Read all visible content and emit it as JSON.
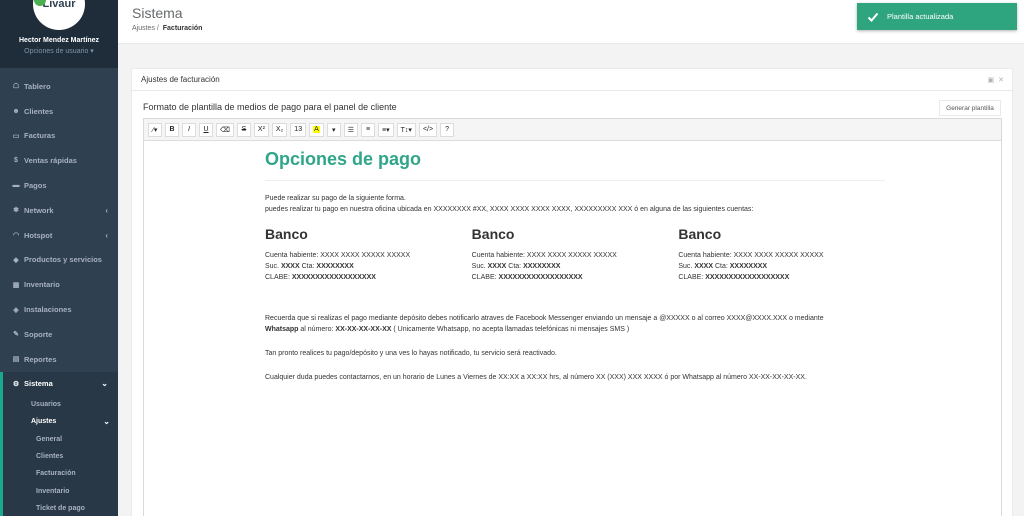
{
  "brand": {
    "logo_text": "Livaur"
  },
  "user": {
    "name": "Hector Mendez Martínez",
    "options": "Opciones de usuario ▾"
  },
  "nav": [
    {
      "icon": "dashboard-icon",
      "glyph": "☖",
      "label": "Tablero"
    },
    {
      "icon": "users-icon",
      "glyph": "☻",
      "label": "Clientes"
    },
    {
      "icon": "file-icon",
      "glyph": "▭",
      "label": "Facturas"
    },
    {
      "icon": "dollar-icon",
      "glyph": "$",
      "label": "Ventas rápidas"
    },
    {
      "icon": "money-icon",
      "glyph": "▬",
      "label": "Pagos"
    },
    {
      "icon": "network-icon",
      "glyph": "✱",
      "label": "Network",
      "chevron": "‹"
    },
    {
      "icon": "wifi-icon",
      "glyph": "◠",
      "label": "Hotspot",
      "chevron": "‹"
    },
    {
      "icon": "tags-icon",
      "glyph": "◆",
      "label": "Productos y servicios"
    },
    {
      "icon": "cubes-icon",
      "glyph": "▦",
      "label": "Inventario"
    },
    {
      "icon": "install-icon",
      "glyph": "◈",
      "label": "Instalaciones"
    },
    {
      "icon": "wrench-icon",
      "glyph": "✎",
      "label": "Soporte"
    },
    {
      "icon": "book-icon",
      "glyph": "▤",
      "label": "Reportes"
    },
    {
      "icon": "cogs-icon",
      "glyph": "⚙",
      "label": "Sistema",
      "chevron": "⌄"
    }
  ],
  "subnav": {
    "usuarios": "Usuarios",
    "ajustes": "Ajustes",
    "ajustes_chevron": "⌄",
    "ajustes_items": [
      "General",
      "Clientes",
      "Facturación",
      "Inventario",
      "Ticket de pago"
    ]
  },
  "header": {
    "title": "Sistema",
    "crumb_parent": "Ajustes",
    "crumb_sep": "/",
    "crumb_current": "Facturación"
  },
  "toast": {
    "text": "Plantilla actualizada"
  },
  "panel": {
    "title": "Ajustes de facturación",
    "tools": [
      "▣",
      "✕"
    ],
    "section_title": "Formato de plantilla de medios de pago para el panel de cliente",
    "generate_button": "Generar plantilla"
  },
  "toolbar": {
    "magic": "⁄▾",
    "bold": "B",
    "italic": "I",
    "underline": "U",
    "eraser": "⌫",
    "strike": "S",
    "sup": "X²",
    "sub": "X₂",
    "font_size": "13",
    "color": "A",
    "color_caret": "▾",
    "ul": "☰",
    "ol": "≡",
    "align": "≡▾",
    "height": "T↕▾",
    "code": "</>",
    "help": "?"
  },
  "template": {
    "title": "Opciones de pago",
    "intro_1": "Puede realizar su pago de la siguiente forma.",
    "intro_2": "puedes realizar tu pago en nuestra oficina ubicada en XXXXXXXX #XX, XXXX XXXX XXXX XXXX, XXXXXXXXX XXX ó en alguna de las siguientes cuentas:",
    "banks": [
      {
        "name": "Banco",
        "holder": "Cuenta habiente: XXXX XXXX XXXXX XXXXX",
        "suc_label": "Suc.",
        "suc": "XXXX",
        "cta_label": "Cta:",
        "cta": "XXXXXXXX",
        "clabe_label": "CLABE:",
        "clabe": "XXXXXXXXXXXXXXXXXX"
      },
      {
        "name": "Banco",
        "holder": "Cuenta habiente: XXXX XXXX XXXXX XXXXX",
        "suc_label": "Suc.",
        "suc": "XXXX",
        "cta_label": "Cta:",
        "cta": "XXXXXXXX",
        "clabe_label": "CLABE:",
        "clabe": "XXXXXXXXXXXXXXXXXX"
      },
      {
        "name": "Banco",
        "holder": "Cuenta habiente: XXXX XXXX XXXXX XXXXX",
        "suc_label": "Suc.",
        "suc": "XXXX",
        "cta_label": "Cta:",
        "cta": "XXXXXXXX",
        "clabe_label": "CLABE:",
        "clabe": "XXXXXXXXXXXXXXXXXX"
      }
    ],
    "note_1a": "Recuerda que si realizas el pago mediante depósito debes notificarlo atraves de Facebook Messenger enviando un mensaje a @XXXXX o al correo XXXX@XXXX.XXX o mediante",
    "note_1_whatsapp": "Whatsapp",
    "note_1b": " al número: ",
    "note_1_number": "XX-XX-XX-XX-XX",
    "note_1c": " ( Unicamente Whatsapp, no acepta llamadas telefónicas ni mensajes SMS )",
    "note_2": "Tan pronto realices tu pago/depósito y una ves lo hayas notificado, tu servicio será reactivado.",
    "note_3": "Cualquier duda puedes contactarnos, en un horario de Lunes a Viernes de XX:XX a XX:XX hrs, al número XX (XXX) XXX XXXX ó por Whatsapp al número XX-XX-XX-XX-XX."
  }
}
